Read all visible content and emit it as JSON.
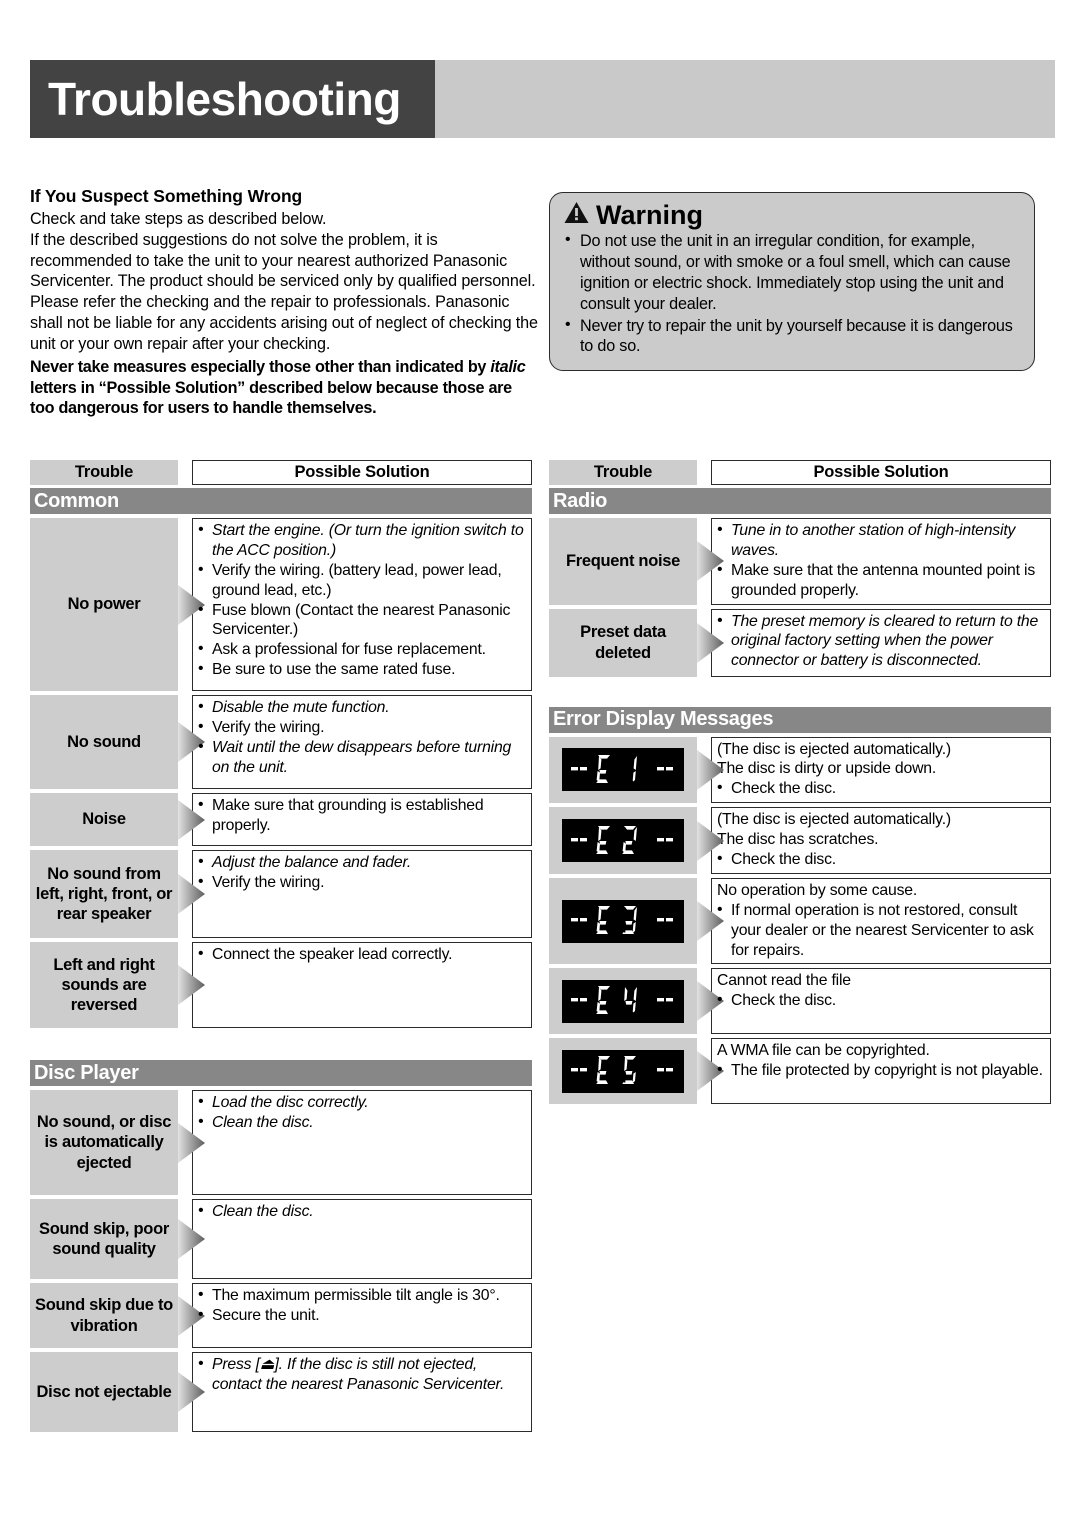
{
  "header": {
    "title": "Troubleshooting"
  },
  "intro": {
    "heading": "If You Suspect Something Wrong",
    "p1": "Check and take steps as described below.",
    "p2": "If the described suggestions do not solve the problem, it is recommended to take the unit to your nearest authorized Panasonic Servicenter. The product should be serviced only by qualified personnel. Please refer the checking and the repair to professionals. Panasonic shall not be liable for any accidents arising out of neglect of checking the unit or your own repair after your checking.",
    "bold_pre": "Never take measures especially those other than indicated by ",
    "bold_italic": "italic",
    "bold_post": " letters in “Possible Solution” described below because those are too dangerous for users to handle themselves."
  },
  "warning": {
    "icon": "warning-triangle-icon",
    "title": "Warning",
    "items": [
      "Do not use the unit in an irregular condition, for example, without sound, or with smoke or a foul smell, which can cause ignition or electric shock. Immediately stop using the unit and consult your dealer.",
      "Never try to repair the unit by yourself because it is dangerous to do so."
    ]
  },
  "table_headers": {
    "trouble": "Trouble",
    "solution": "Possible Solution"
  },
  "sections": {
    "common": {
      "title": "Common",
      "rows": [
        {
          "trouble": "No power",
          "solutions": [
            {
              "text": "Start the engine. (Or turn the ignition switch to the ACC position.)",
              "italic": true
            },
            {
              "text": "Verify the wiring. (battery lead, power lead, ground lead, etc.)",
              "italic": false
            },
            {
              "text": "Fuse blown (Contact the nearest Panasonic Servicenter.)",
              "italic": false
            },
            {
              "text": "Ask a professional for fuse replacement.",
              "italic": false
            },
            {
              "text": "Be sure to use the same rated fuse.",
              "italic": false
            }
          ]
        },
        {
          "trouble": "No sound",
          "solutions": [
            {
              "text": "Disable the mute function.",
              "italic": true
            },
            {
              "text": "Verify the wiring.",
              "italic": false
            },
            {
              "text": "Wait until the dew disappears before turning on the unit.",
              "italic": true
            }
          ]
        },
        {
          "trouble": "Noise",
          "solutions": [
            {
              "text": "Make sure that grounding is established properly.",
              "italic": false
            }
          ]
        },
        {
          "trouble": "No sound from left, right, front, or rear speaker",
          "solutions": [
            {
              "text": "Adjust the balance and fader.",
              "italic": true
            },
            {
              "text": "Verify the wiring.",
              "italic": false
            }
          ]
        },
        {
          "trouble": "Left and right sounds are reversed",
          "solutions": [
            {
              "text": "Connect the speaker lead correctly.",
              "italic": false
            }
          ]
        }
      ]
    },
    "disc_player": {
      "title": "Disc Player",
      "rows": [
        {
          "trouble": "No sound, or disc is automatically ejected",
          "solutions": [
            {
              "text": "Load the disc correctly.",
              "italic": true
            },
            {
              "text": "Clean the disc.",
              "italic": true
            }
          ]
        },
        {
          "trouble": "Sound skip, poor sound quality",
          "solutions": [
            {
              "text": "Clean the disc.",
              "italic": true
            }
          ]
        },
        {
          "trouble": "Sound skip due to vibration",
          "solutions": [
            {
              "text": "The maximum permissible tilt angle is 30°.",
              "italic": false
            },
            {
              "text": "Secure the unit.",
              "italic": false
            }
          ]
        },
        {
          "trouble": "Disc not ejectable",
          "solutions": [
            {
              "text": "Press [⏏]. If the disc is still not ejected, contact the nearest Panasonic Servicenter.",
              "italic": true
            }
          ]
        }
      ]
    },
    "radio": {
      "title": "Radio",
      "rows": [
        {
          "trouble": "Frequent noise",
          "solutions": [
            {
              "text": "Tune in to another station of high-intensity waves.",
              "italic": true
            },
            {
              "text": "Make sure that the antenna mounted point is grounded properly.",
              "italic": false
            }
          ]
        },
        {
          "trouble": "Preset data deleted",
          "solutions": [
            {
              "text": "The preset memory is cleared to return to the original factory setting when the power connector or battery is disconnected.",
              "italic": true
            }
          ]
        }
      ]
    },
    "error_display": {
      "title": "Error Display Messages",
      "rows": [
        {
          "code": "E1",
          "display": "-- E 1 --",
          "lines": [
            "(The disc is ejected automatically.)",
            "The disc is dirty or upside down."
          ],
          "bullets": [
            "Check the disc."
          ]
        },
        {
          "code": "E2",
          "display": "-- E 2 --",
          "lines": [
            "(The disc is ejected automatically.)",
            "The disc has scratches."
          ],
          "bullets": [
            "Check the disc."
          ]
        },
        {
          "code": "E3",
          "display": "-- E 3 --",
          "lines": [
            "No operation by some cause."
          ],
          "bullets": [
            "If normal operation is not restored, consult your dealer or the nearest Servicenter to ask for repairs."
          ]
        },
        {
          "code": "E4",
          "display": "-- E 4 --",
          "lines": [
            "Cannot read the file"
          ],
          "bullets": [
            "Check the disc."
          ]
        },
        {
          "code": "E5",
          "display": "-- E 5 --",
          "lines": [
            "A WMA file can be copyrighted."
          ],
          "bullets": [
            "The file protected by copyright is not playable."
          ]
        }
      ]
    }
  },
  "colors": {
    "header_dark": "#434343",
    "header_light": "#c9c9c9",
    "section_bar": "#878787",
    "cell_gray": "#cdcdcd",
    "warning_bg": "#cbcbcb",
    "lcd_bg": "#000000",
    "lcd_fg": "#ffffff"
  }
}
